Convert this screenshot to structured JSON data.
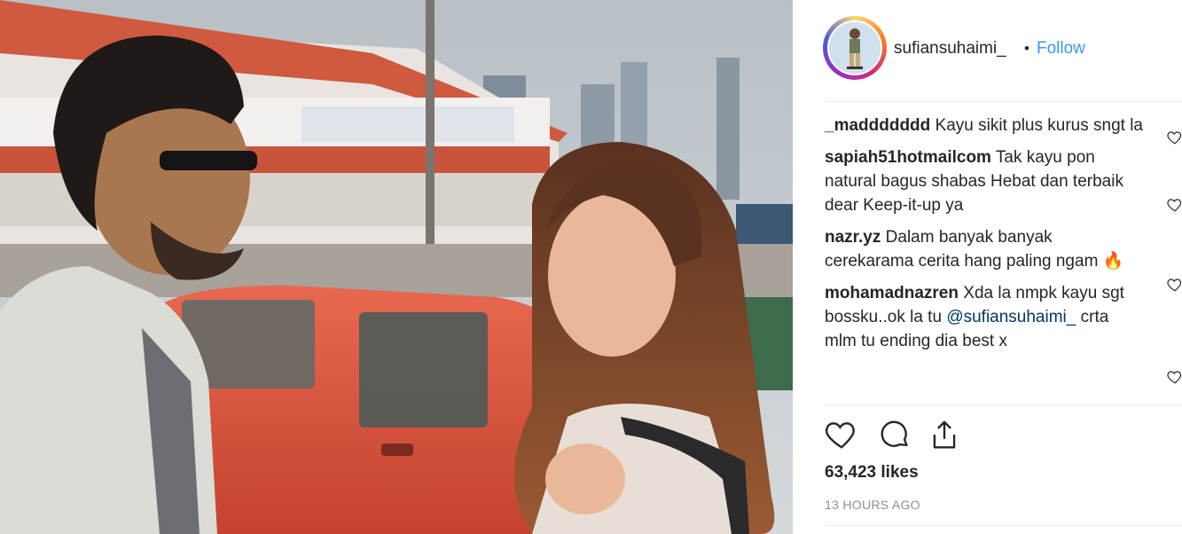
{
  "post": {
    "username": "sufiansuhaimi_",
    "separator": "•",
    "follow_label": "Follow"
  },
  "comments": [
    {
      "user": "_maddddddd",
      "text": "Kayu sikit plus kurus sngt la"
    },
    {
      "user": "sapiah51hotmailcom",
      "text": "Tak kayu pon natural bagus shabas Hebat dan terbaik dear Keep-it-up ya"
    },
    {
      "user": "nazr.yz",
      "text": "Dalam banyak banyak cerekarama cerita hang paling ngam 🔥"
    },
    {
      "user": "mohamadnazren",
      "text": "Xda la nmpk kayu sgt bossku..ok la tu",
      "mention": "@sufiansuhaimi_",
      "text_after": "crta mlm tu ending dia best x"
    }
  ],
  "likes": "63,423 likes",
  "time_ago": "13 HOURS AGO",
  "icons": {
    "like": "heart-icon",
    "comment": "comment-bubble-icon",
    "share": "share-icon",
    "comment_like": "small-heart-icon"
  },
  "colors": {
    "follow": "#3897f0",
    "text": "#262626",
    "muted": "#8e8e8e"
  }
}
